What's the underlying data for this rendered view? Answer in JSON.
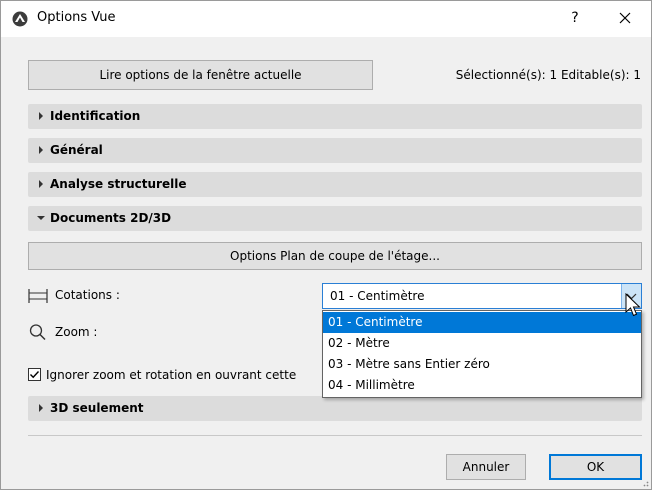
{
  "window": {
    "title": "Options Vue",
    "help_label": "?"
  },
  "top": {
    "read_button": "Lire options de la fenêtre actuelle",
    "selection_info": "Sélectionné(s): 1 Editable(s): 1"
  },
  "sections": {
    "identification": "Identification",
    "general": "Général",
    "structural": "Analyse structurelle",
    "documents": "Documents 2D/3D",
    "only3d": "3D seulement"
  },
  "documents": {
    "plan_button": "Options Plan de coupe de l'étage...",
    "dimensions_label": "Cotations :",
    "dimensions_value": "01 - Centimètre",
    "zoom_label": "Zoom :",
    "ignore_checkbox_label": "Ignorer zoom et rotation en ouvrant cette",
    "ignore_checked": true,
    "dropdown_options": [
      "01 - Centimètre",
      "02 - Mètre",
      "03 - Mètre sans Entier zéro",
      "04 - Millimètre"
    ],
    "selected_option_index": 0
  },
  "footer": {
    "cancel_label": "Annuler",
    "ok_label": "OK"
  },
  "colors": {
    "accent": "#0078d7",
    "section_bg": "#dcdcdc",
    "dialog_bg": "#f0f0f0"
  },
  "icons": [
    "app-logo-icon",
    "close-icon",
    "expand-triangle-icon",
    "collapse-triangle-icon",
    "dimension-icon",
    "magnifier-icon",
    "checkmark-icon",
    "chevron-down-icon",
    "mouse-pointer-icon",
    "resize-grip-icon"
  ]
}
